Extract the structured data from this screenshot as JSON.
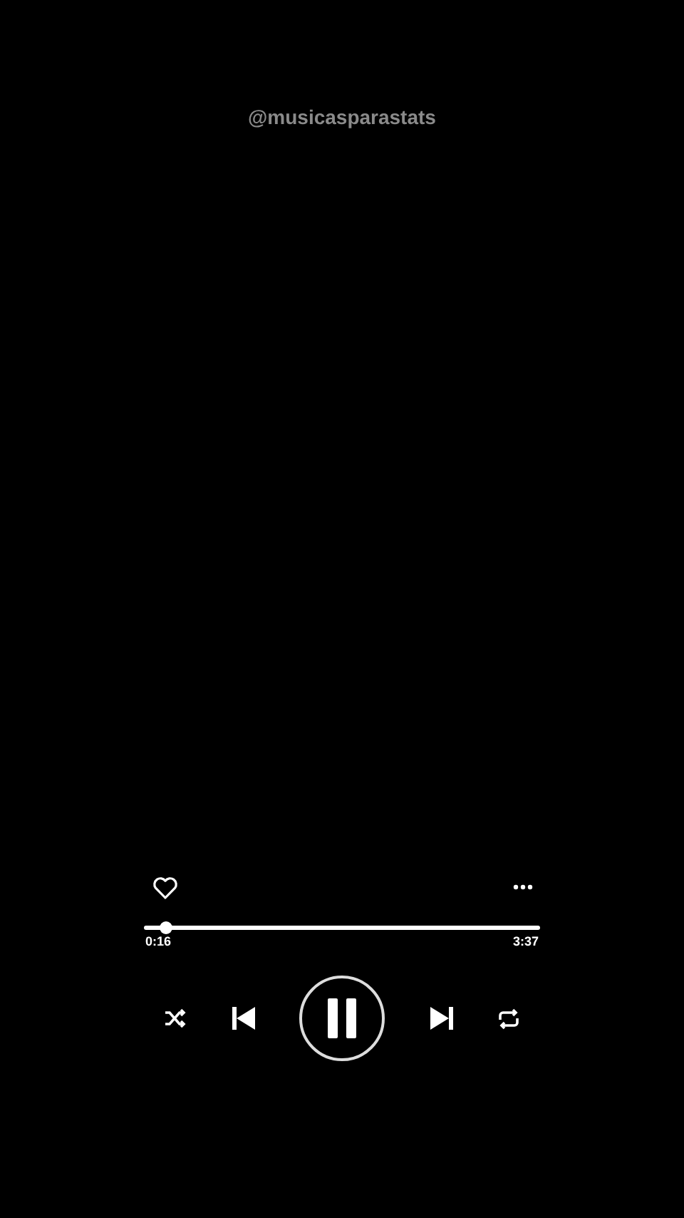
{
  "handle": "@musicasparastats",
  "player": {
    "liked": false,
    "progress": {
      "level": 0.054,
      "elapsed": "0:16",
      "duration": "3:37"
    },
    "playing": true,
    "shuffle": false,
    "repeat": false
  }
}
